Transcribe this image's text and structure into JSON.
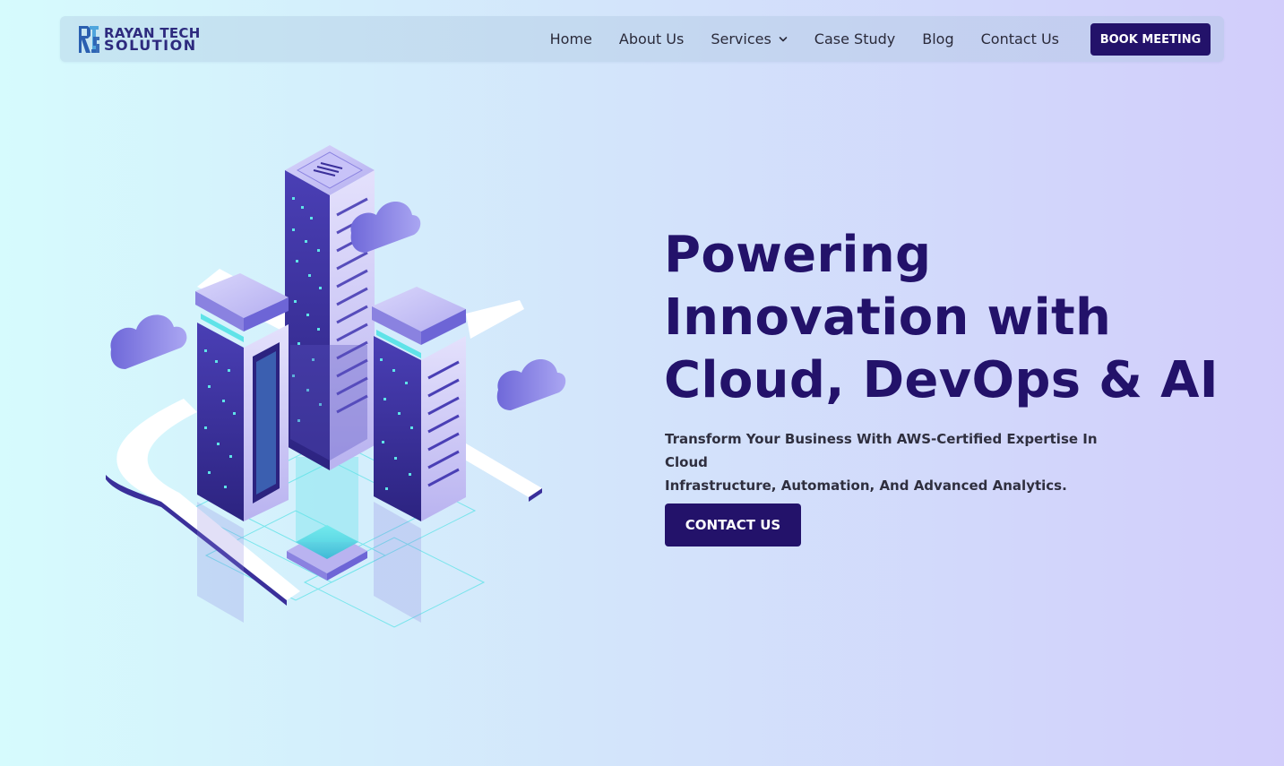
{
  "brand": {
    "line1": "RAYAN TECH",
    "line2": "SOLUTION",
    "icon": "rts-logo-icon",
    "color": "#2d2a7e"
  },
  "nav": {
    "items": [
      {
        "label": "Home"
      },
      {
        "label": "About Us"
      },
      {
        "label": "Services",
        "has_dropdown": true
      },
      {
        "label": "Case Study"
      },
      {
        "label": "Blog"
      },
      {
        "label": "Contact Us"
      }
    ],
    "cta_label": "BOOK MEETING"
  },
  "hero": {
    "title_lines": [
      "Powering",
      "Innovation with",
      "Cloud, DevOps & AI"
    ],
    "subtitle_lines": [
      "Transform Your Business With AWS-Certified Expertise In Cloud",
      "Infrastructure, Automation, And Advanced Analytics."
    ],
    "cta_label": "CONTACT US",
    "illustration": "isometric-cloud-servers-illustration"
  },
  "colors": {
    "primary": "#23126a",
    "text": "#2f2f3f",
    "building_dark": "#3a2f9a",
    "building_light": "#c9c5f5",
    "accent_cyan": "#5fe3e8"
  }
}
